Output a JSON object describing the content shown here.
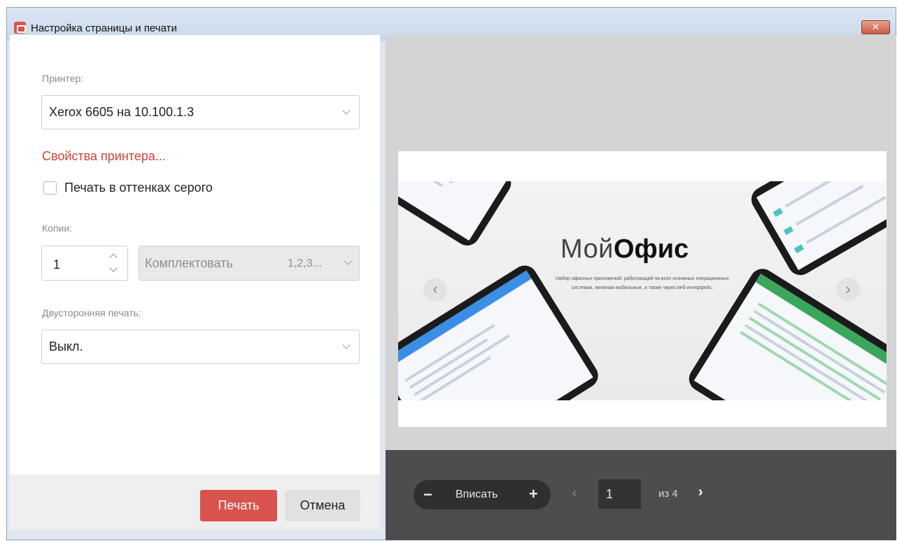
{
  "window": {
    "title": "Настройка страницы и печати",
    "close_label": "✕"
  },
  "printer": {
    "label": "Принтер:",
    "selected": "Xerox 6605 на 10.100.1.3",
    "properties_link": "Свойства принтера..."
  },
  "grayscale": {
    "label": "Печать в оттенках серого",
    "checked": false
  },
  "copies": {
    "label": "Копии:",
    "value": "1",
    "collate_label": "Комплектовать",
    "collate_order": "1,2,3..."
  },
  "duplex": {
    "label": "Двусторонняя печать:",
    "selected": "Выкл."
  },
  "buttons": {
    "print": "Печать",
    "cancel": "Отмена"
  },
  "preview": {
    "logo_light": "Мой",
    "logo_bold": "Офис",
    "tagline": "Набор офисных приложений, работающий на всех основных операционных системах, включая мобильные, а также через веб-интерфейс."
  },
  "toolbar": {
    "zoom_minus": "−",
    "zoom_label": "Вписать",
    "zoom_plus": "+",
    "prev": "‹",
    "page": "1",
    "of_total": "из 4",
    "next": "›"
  },
  "colors": {
    "accent": "#d9534f",
    "toolbar_bg": "#4d4d4d",
    "preview_bg": "#d4d4d4"
  }
}
